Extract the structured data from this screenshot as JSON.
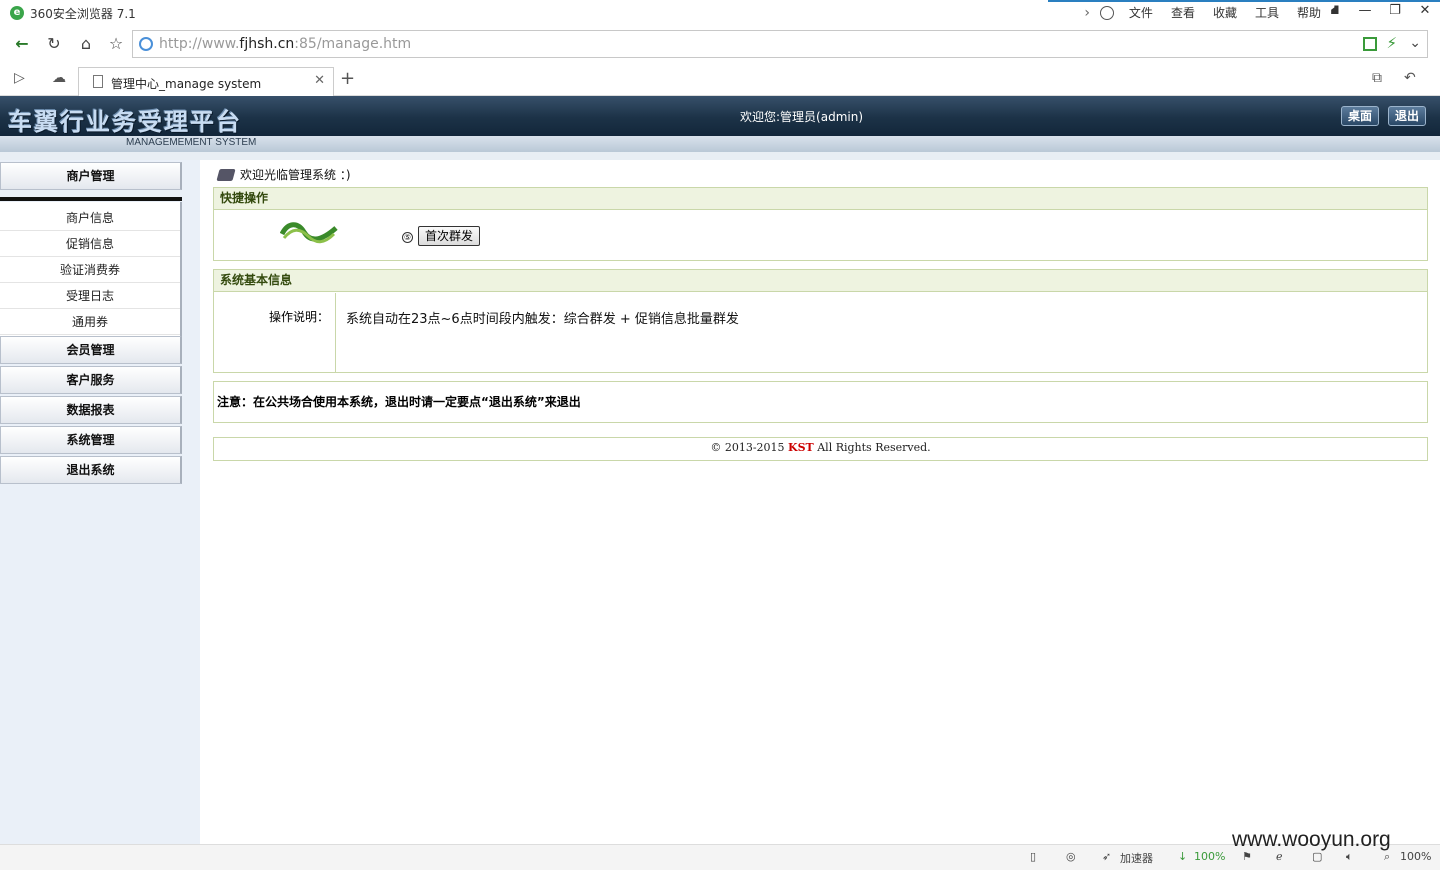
{
  "browser": {
    "app_title": "360安全浏览器 7.1",
    "menu": [
      "文件",
      "查看",
      "收藏",
      "工具",
      "帮助"
    ],
    "window_buttons": [
      "⛘",
      "—",
      "❐",
      "✕"
    ],
    "url_prefix": "http://www.",
    "url_domain": "fjhsh.cn",
    "url_suffix": ":85/manage.htm",
    "tab_title": "管理中心_manage system",
    "status": {
      "accelerator": "加速器",
      "speed": "100%",
      "zoom": "100%"
    }
  },
  "header": {
    "logo": "车翼行业务受理平台",
    "subtitle": "MANAGEMEMENT SYSTEM",
    "welcome": "欢迎您:管理员(admin)",
    "desktop_btn": "桌面",
    "logout_btn": "退出"
  },
  "sidebar": {
    "sections": [
      {
        "label": "商户管理"
      },
      {
        "label": "会员管理"
      },
      {
        "label": "客户服务"
      },
      {
        "label": "数据报表"
      },
      {
        "label": "系统管理"
      },
      {
        "label": "退出系统"
      }
    ],
    "items": [
      {
        "label": "商户信息"
      },
      {
        "label": "促销信息"
      },
      {
        "label": "验证消费券"
      },
      {
        "label": "受理日志"
      },
      {
        "label": "通用券"
      }
    ]
  },
  "main": {
    "breadcrumb": "欢迎光临管理系统 ：)",
    "quick": {
      "title": "快捷操作",
      "radio_mark": "⑤",
      "button": "首次群发"
    },
    "info": {
      "title": "系统基本信息",
      "label": "操作说明：",
      "text": "系统自动在23点~6点时间段内触发：综合群发 + 促销信息批量群发"
    },
    "notice": "注意：在公共场合使用本系统，退出时请一定要点“退出系统”来退出",
    "footer": {
      "prefix": "© 2013-2015 ",
      "brand": "KST",
      "suffix": " All Rights Reserved."
    }
  },
  "watermark": "www.wooyun.org",
  "colors": {
    "header_bg": "#1c3247",
    "panel_border": "#c9d7a9",
    "panel_title": "#344a0e",
    "sidebar_bg": "#eaf0f8",
    "brand_red": "#cc0000"
  }
}
